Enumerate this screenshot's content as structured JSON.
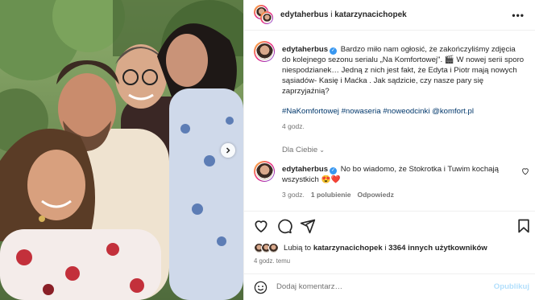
{
  "header": {
    "user1": "edytaherbus",
    "conjunction": " i ",
    "user2": "katarzynacichopek",
    "more_icon": "more-horizontal-icon"
  },
  "caption": {
    "username": "edytaherbus",
    "text": "Bardzo miło nam ogłosić, że zakończyliśmy zdjęcia do kolejnego sezonu serialu „Na Komfortowej\". 🎬 W nowej serii sporo niespodzianek… Jedną z nich jest fakt, że Edyta i Piotr mają nowych sąsiadów- Kasię i Maćka . Jak sądzicie, czy nasze pary się zaprzyjaźnią?",
    "hashtags": "#NaKomfortowej #nowaseria #noweodcinki @komfort.pl",
    "time": "4 godz."
  },
  "comments_section": {
    "label": "Dla Ciebie",
    "comment": {
      "username": "edytaherbus",
      "text": "No bo wiadomo, że Stokrotka i Tuwim kochają wszystkich 😍❤️",
      "time": "3 godz.",
      "likes": "1 polubienie",
      "reply": "Odpowiedz"
    }
  },
  "likes": {
    "prefix": "Lubią to ",
    "user": "katarzynacichopek",
    "middle": " i ",
    "count": "3364 innych użytkowników"
  },
  "post_time": "4 godz. temu",
  "add_comment": {
    "placeholder": "Dodaj komentarz…",
    "post_label": "Opublikuj"
  },
  "colors": {
    "link": "#00376b",
    "verified": "#3897f0",
    "muted": "#737373",
    "post_disabled": "#b2dffc"
  }
}
